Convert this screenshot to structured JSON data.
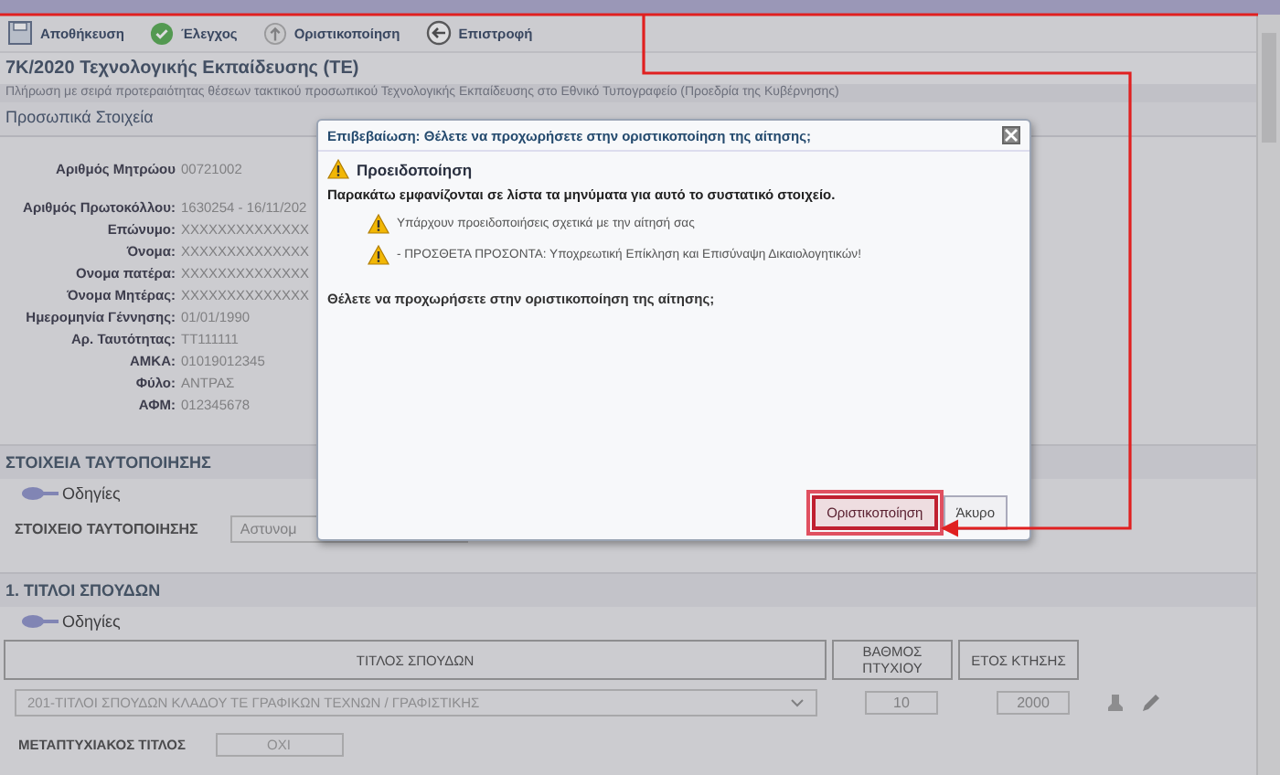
{
  "toolbar": [
    {
      "kind": "save",
      "label": "Αποθήκευση"
    },
    {
      "kind": "check",
      "label": "Έλεγχος"
    },
    {
      "kind": "upload",
      "label": "Οριστικοποίηση"
    },
    {
      "kind": "back",
      "label": "Επιστροφή"
    }
  ],
  "title": "7Κ/2020 Τεχνολογικής Εκπαίδευσης (ΤΕ)",
  "subtitle": "Πλήρωση με σειρά προτεραιότητας θέσεων τακτικού προσωπικού Τεχνολογικής Εκπαίδευσης στο Εθνικό Τυπογραφείο (Προεδρία της Κυβέρνησης)",
  "personal": {
    "title": "Προσωπικά Στοιχεία",
    "fields": [
      {
        "label": "Αριθμός Μητρώου",
        "value": "00721002"
      },
      {
        "label": "Αριθμός Πρωτοκόλλου:",
        "value": "1630254 - 16/11/202"
      },
      {
        "label": "Επώνυμο:",
        "value": "XXXXXXXXXXXXXX"
      },
      {
        "label": "Όνομα:",
        "value": "XXXXXXXXXXXXXX"
      },
      {
        "label": "Ονομα πατέρα:",
        "value": "XXXXXXXXXXXXXX"
      },
      {
        "label": "Όνομα Μητέρας:",
        "value": "XXXXXXXXXXXXXX"
      },
      {
        "label": "Ημερομηνία Γέννησης:",
        "value": "01/01/1990"
      },
      {
        "label": "Αρ. Ταυτότητας:",
        "value": "TT111111"
      },
      {
        "label": "ΑΜΚΑ:",
        "value": "01019012345"
      },
      {
        "label": "Φύλο:",
        "value": "ΑΝΤΡΑΣ"
      },
      {
        "label": "ΑΦΜ:",
        "value": "012345678"
      }
    ]
  },
  "identification": {
    "title": "ΣΤΟΙΧΕΙΑ ΤΑΥΤΟΠΟΙΗΣΗΣ",
    "help": "Οδηγίες",
    "field_label": "ΣΤΟΙΧΕΙΟ ΤΑΥΤΟΠΟΙΗΣΗΣ",
    "field_value": "Αστυνομ"
  },
  "studies": {
    "title": "1. ΤΙΤΛΟΙ ΣΠΟΥΔΩΝ",
    "help": "Οδηγίες",
    "columns": [
      "ΤΙΤΛΟΣ ΣΠΟΥΔΩΝ",
      "ΒΑΘΜΟΣ ΠΤΥΧΙΟΥ",
      "ΕΤΟΣ ΚΤΗΣΗΣ"
    ],
    "row": {
      "title": "201-ΤΙΤΛΟΙ ΣΠΟΥΔΩΝ ΚΛΑΔΟΥ ΤΕ ΓΡΑΦΙΚΩΝ ΤΕΧΝΩΝ / ΓΡΑΦΙΣΤΙΚΗΣ",
      "grade": "10",
      "year": "2000"
    },
    "postgrad_label": "ΜΕΤΑΠΤΥΧΙΑΚΟΣ ΤΙΤΛΟΣ",
    "postgrad_value": "ΟΧΙ"
  },
  "dialog": {
    "title": "Επιβεβαίωση: Θέλετε να προχωρήσετε στην οριστικοποίηση της αίτησης;",
    "heading": "Προειδοποίηση",
    "intro": "Παρακάτω εμφανίζονται σε λίστα τα μηνύματα για αυτό το συστατικό στοιχείο.",
    "messages": [
      "Υπάρχουν προειδοποιήσεις σχετικά με την αίτησή σας",
      "- ΠΡΟΣΘΕΤΑ ΠΡΟΣΟΝΤΑ: Υποχρεωτική Επίκληση και Επισύναψη Δικαιολογητικών!"
    ],
    "question": "Θέλετε να προχωρήσετε στην οριστικοποίηση της αίτησης;",
    "buttons": [
      {
        "label": "Οριστικοποίηση",
        "selected": true
      },
      {
        "label": "Άκυρο",
        "selected": false
      }
    ]
  }
}
